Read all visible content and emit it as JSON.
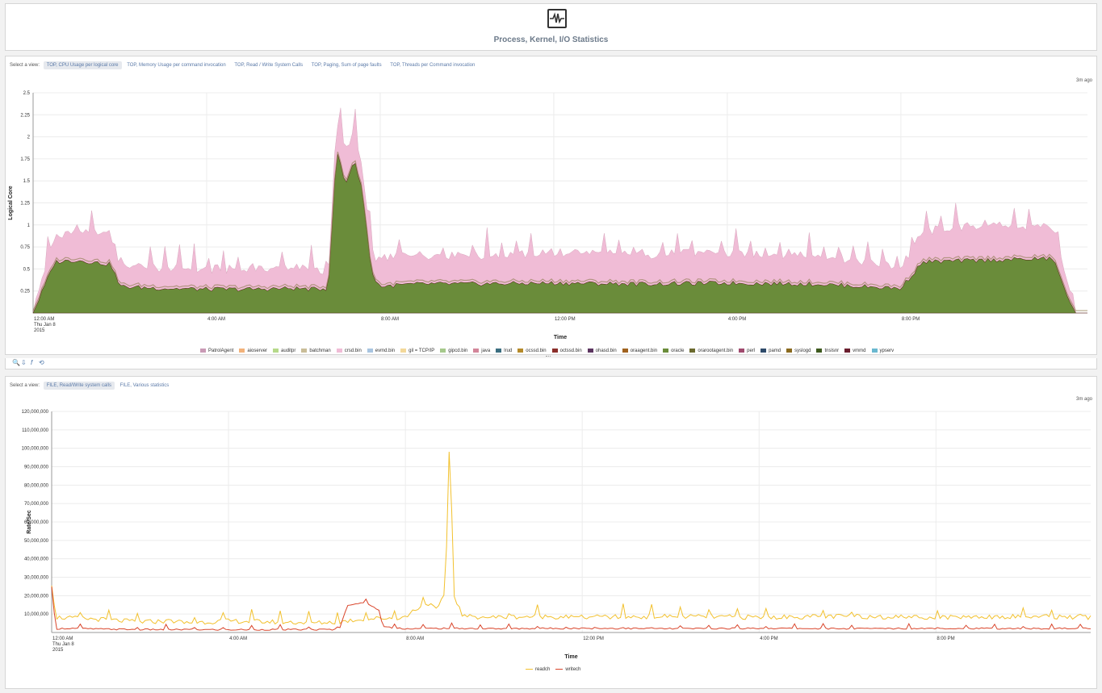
{
  "header": {
    "title": "Process, Kernel, I/O Statistics",
    "icon": "heartbeat-icon"
  },
  "panel1": {
    "select_label": "Select a view:",
    "tabs": [
      {
        "label": "TOP, CPU Usage per logical core",
        "active": true
      },
      {
        "label": "TOP, Memory Usage per command invocation",
        "active": false
      },
      {
        "label": "TOP, Read / Write System Calls",
        "active": false
      },
      {
        "label": "TOP, Paging, Sum of page faults",
        "active": false
      },
      {
        "label": "TOP, Threads per Command invocation",
        "active": false
      }
    ],
    "updated": "3m ago"
  },
  "toolbar": {
    "icons": [
      "zoom-icon",
      "download-icon",
      "function-icon",
      "refresh-icon"
    ],
    "glyphs": [
      "🔍",
      "⇩",
      "f",
      "⟲"
    ]
  },
  "panel2": {
    "select_label": "Select a view:",
    "tabs": [
      {
        "label": "FILE, Read/Write system calls",
        "active": true
      },
      {
        "label": "FILE, Various statistics",
        "active": false
      }
    ],
    "updated": "3m ago"
  },
  "chart_data": [
    {
      "type": "area",
      "stacked": true,
      "ylabel": "Logical Core",
      "xlabel": "Time",
      "ylim": [
        0,
        2.5
      ],
      "yticks": [
        "0.25",
        "0.5",
        "0.75",
        "1",
        "1.25",
        "1.5",
        "1.75",
        "2",
        "2.25",
        "2.5"
      ],
      "xticks": [
        "12:00 AM",
        "4:00 AM",
        "8:00 AM",
        "12:00 PM",
        "4:00 PM",
        "8:00 PM"
      ],
      "x_first_label_extra": [
        "Thu Jan 8",
        "2015"
      ],
      "x_hours_range": [
        0,
        24.3
      ],
      "grid": true,
      "legend_position": "bottom",
      "legend": [
        {
          "name": "PatrolAgent",
          "color": "#c99ab5"
        },
        {
          "name": "aioserver",
          "color": "#f2b27a"
        },
        {
          "name": "auditpr",
          "color": "#b6d98a"
        },
        {
          "name": "batchman",
          "color": "#c9bd98"
        },
        {
          "name": "crsd.bin",
          "color": "#f0bcd6"
        },
        {
          "name": "evmd.bin",
          "color": "#a8c4e0"
        },
        {
          "name": "gil = TCP/IP",
          "color": "#f3d89a"
        },
        {
          "name": "gipcd.bin",
          "color": "#a6c98c"
        },
        {
          "name": "java",
          "color": "#d3869a"
        },
        {
          "name": "lrud",
          "color": "#3b6e80"
        },
        {
          "name": "ocssd.bin",
          "color": "#b58a2a"
        },
        {
          "name": "octssd.bin",
          "color": "#8b2e2a"
        },
        {
          "name": "ohasd.bin",
          "color": "#5c3560"
        },
        {
          "name": "oraagent.bin",
          "color": "#a0621e"
        },
        {
          "name": "oracle",
          "color": "#6a8c3a"
        },
        {
          "name": "orarootagent.bin",
          "color": "#6b6a2e"
        },
        {
          "name": "perl",
          "color": "#a04a6e"
        },
        {
          "name": "pamd",
          "color": "#2e4a6a"
        },
        {
          "name": "syslogd",
          "color": "#8a6a1e"
        },
        {
          "name": "tnslsnr",
          "color": "#3e5a1e"
        },
        {
          "name": "vmmd",
          "color": "#6a1e2e"
        },
        {
          "name": "ypserv",
          "color": "#6ab8d0"
        }
      ],
      "series": [
        {
          "name": "oracle",
          "hours": [
            0,
            0.5,
            1,
            1.8,
            2,
            3,
            4,
            5,
            6,
            6.5,
            6.8,
            7.0,
            7.2,
            7.4,
            7.6,
            7.8,
            8,
            8.5,
            9,
            10,
            12,
            14,
            16,
            18,
            20,
            20.5,
            22,
            23.5,
            24
          ],
          "values": [
            0,
            0.58,
            0.6,
            0.55,
            0.3,
            0.28,
            0.27,
            0.27,
            0.28,
            0.27,
            0.28,
            1.85,
            1.45,
            1.75,
            1.35,
            0.45,
            0.3,
            0.32,
            0.33,
            0.33,
            0.34,
            0.33,
            0.34,
            0.33,
            0.28,
            0.58,
            0.6,
            0.62,
            0
          ]
        },
        {
          "name": "crsd.bin",
          "hours": [
            0,
            0.5,
            1,
            1.8,
            2,
            3,
            4,
            5,
            6,
            6.5,
            6.8,
            7.0,
            7.2,
            7.4,
            7.6,
            7.8,
            8,
            8.5,
            9,
            10,
            12,
            14,
            16,
            18,
            20,
            20.5,
            22,
            23.5,
            24
          ],
          "values": [
            0,
            0.25,
            0.3,
            0.3,
            0.2,
            0.2,
            0.18,
            0.18,
            0.2,
            0.18,
            0.12,
            0.3,
            0.35,
            0.3,
            0.2,
            0.2,
            0.25,
            0.3,
            0.28,
            0.28,
            0.3,
            0.3,
            0.3,
            0.3,
            0.2,
            0.3,
            0.35,
            0.32,
            0
          ]
        }
      ]
    },
    {
      "type": "line",
      "ylabel": "Rate/Sec",
      "xlabel": "Time",
      "ylim": [
        0,
        120000000
      ],
      "yticks": [
        "10,000,000",
        "20,000,000",
        "30,000,000",
        "40,000,000",
        "50,000,000",
        "60,000,000",
        "70,000,000",
        "80,000,000",
        "90,000,000",
        "100,000,000",
        "110,000,000",
        "120,000,000"
      ],
      "xticks": [
        "12:00 AM",
        "4:00 AM",
        "8:00 AM",
        "12:00 PM",
        "4:00 PM",
        "8:00 PM"
      ],
      "x_first_label_extra": [
        "Thu Jan 8",
        "2015"
      ],
      "x_hours_range": [
        0,
        23.5
      ],
      "grid": true,
      "legend_position": "bottom",
      "series": [
        {
          "name": "readch",
          "color": "#f2c12e",
          "hours": [
            0,
            0.1,
            0.5,
            1,
            2,
            2.8,
            3,
            4,
            5,
            6,
            6.5,
            7,
            7.5,
            8,
            8.2,
            8.5,
            8.7,
            8.9,
            9.0,
            9.1,
            9.3,
            10,
            11,
            12,
            14,
            16,
            18,
            20,
            22,
            23.5
          ],
          "values": [
            26000000,
            8000000,
            7500000,
            7000000,
            5500000,
            6000000,
            5000000,
            6000000,
            5500000,
            5000000,
            5500000,
            7000000,
            7500000,
            8000000,
            12000000,
            16000000,
            12000000,
            20000000,
            108000000,
            20000000,
            8500000,
            8000000,
            8500000,
            8000000,
            8500000,
            8000000,
            8500000,
            8000000,
            8500000,
            8000000
          ]
        },
        {
          "name": "writech",
          "color": "#d9452b",
          "hours": [
            0,
            0.1,
            0.5,
            1,
            2,
            3,
            4,
            5,
            6,
            6.5,
            6.7,
            7,
            7.2,
            7.4,
            7.5,
            8,
            9,
            10,
            12,
            14,
            16,
            18,
            20,
            22,
            23.5
          ],
          "values": [
            22000000,
            2000000,
            2200000,
            1800000,
            1500000,
            1500000,
            1400000,
            1500000,
            1500000,
            1500000,
            15000000,
            16000000,
            15000000,
            12000000,
            3000000,
            2000000,
            2200000,
            2000000,
            2200000,
            2000000,
            2200000,
            2000000,
            2200000,
            2000000,
            2200000
          ]
        }
      ]
    }
  ]
}
